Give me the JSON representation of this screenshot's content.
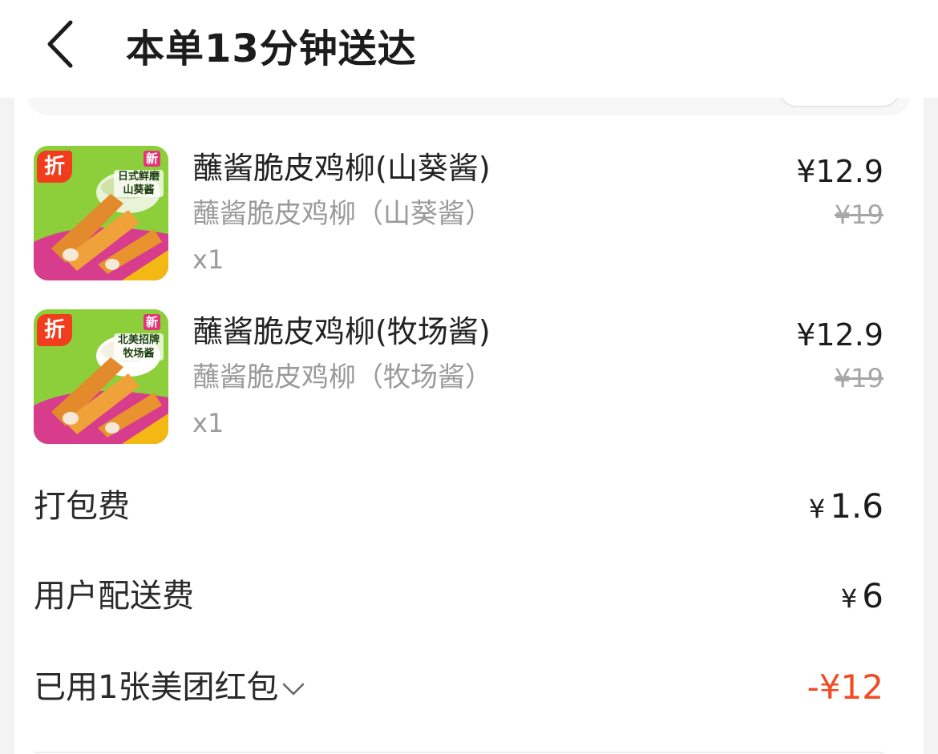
{
  "header": {
    "title": "本单13分钟送达",
    "back_icon": "chevron-left-icon"
  },
  "items": [
    {
      "name": "蘸酱脆皮鸡柳(山葵酱)",
      "spec": "蘸酱脆皮鸡柳（山葵酱）",
      "qty": "x1",
      "price": "¥12.9",
      "original_price": "¥19",
      "badge": "折",
      "image_tag_new": "新",
      "image_tag_flavor": "日式鲜磨山葵酱",
      "sauce_color": "#cfe3a8"
    },
    {
      "name": "蘸酱脆皮鸡柳(牧场酱)",
      "spec": "蘸酱脆皮鸡柳（牧场酱）",
      "qty": "x1",
      "price": "¥12.9",
      "original_price": "¥19",
      "badge": "折",
      "image_tag_new": "新",
      "image_tag_flavor": "北美招牌牧场酱",
      "sauce_color": "#f4f1e2"
    }
  ],
  "fees": {
    "packing": {
      "label": "打包费",
      "currency": "¥",
      "amount": "1.6"
    },
    "delivery": {
      "label": "用户配送费",
      "currency": "¥",
      "amount": "6"
    },
    "coupon": {
      "label": "已用1张美团红包",
      "value": "-¥12"
    }
  },
  "colors": {
    "accent": "#f24a22",
    "badge": "#f23c1e",
    "muted_text": "#9a9a9a",
    "image_green": "#8ccf3a",
    "image_magenta": "#d83c8c"
  }
}
